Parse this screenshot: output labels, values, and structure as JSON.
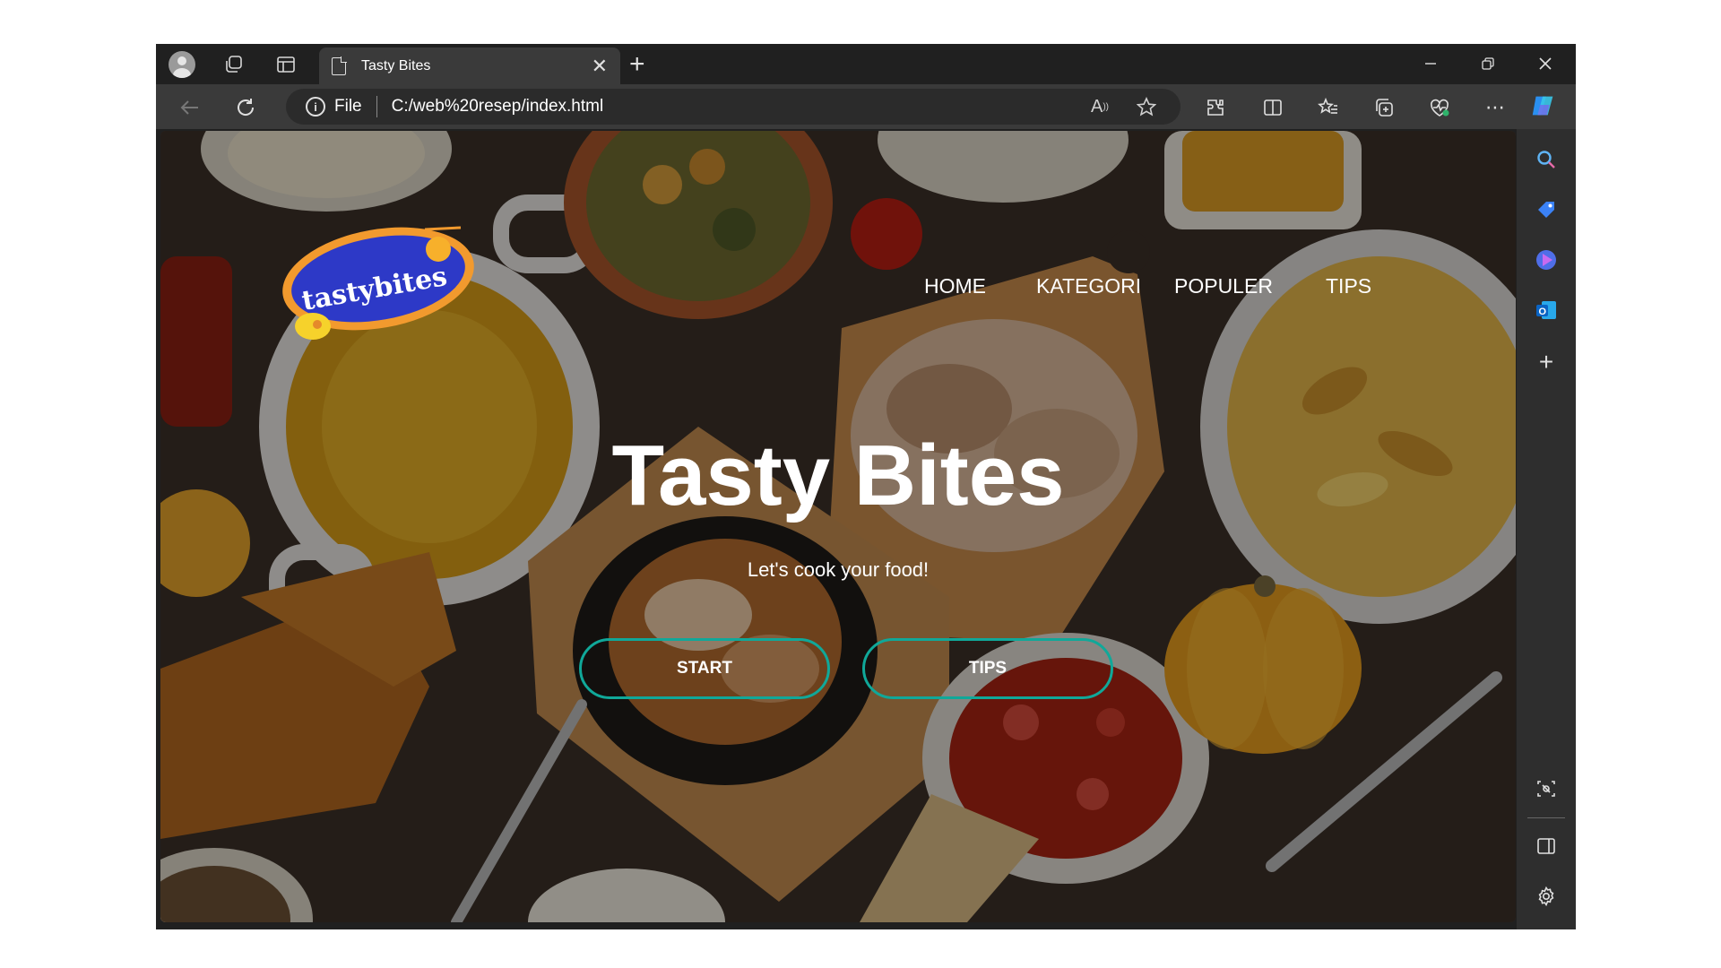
{
  "browser": {
    "tab": {
      "title": "Tasty Bites"
    },
    "address": {
      "scheme_label": "File",
      "url": "C:/web%20resep/index.html"
    }
  },
  "page": {
    "logo_text": "tastybites",
    "nav": [
      {
        "label": "HOME"
      },
      {
        "label": "KATEGORI"
      },
      {
        "label": "POPULER"
      },
      {
        "label": "TIPS"
      }
    ],
    "hero": {
      "title": "Tasty Bites",
      "subtitle": "Let's cook your food!",
      "buttons": [
        {
          "label": "START"
        },
        {
          "label": "TIPS"
        }
      ]
    }
  },
  "colors": {
    "button_border": "#10a899",
    "logo_blue": "#2d39c7",
    "logo_orange": "#f29a2e",
    "chrome_dark": "#202020",
    "toolbar": "#3a3a3a"
  },
  "icons": {
    "tabstrip": [
      "profile-avatar-icon",
      "workspaces-icon",
      "tab-actions-icon",
      "page-icon",
      "close-tab-icon",
      "new-tab-icon"
    ],
    "window": [
      "minimize-icon",
      "restore-icon",
      "close-window-icon"
    ],
    "toolbar": [
      "back-icon",
      "refresh-icon",
      "info-icon",
      "read-aloud-icon",
      "favorite-star-icon",
      "extensions-icon",
      "split-screen-icon",
      "favorites-icon",
      "collections-icon",
      "browser-essentials-icon",
      "more-icon",
      "copilot-icon"
    ],
    "sidebar": [
      "search-icon",
      "shopping-tag-icon",
      "bing-icon",
      "outlook-icon",
      "add-icon",
      "screenshot-icon",
      "sidebar-panel-icon",
      "settings-icon"
    ]
  }
}
